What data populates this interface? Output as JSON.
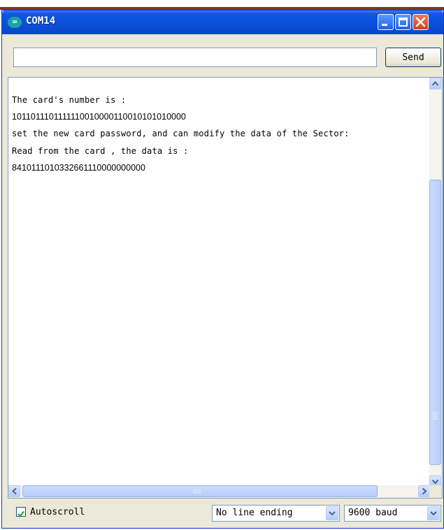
{
  "window": {
    "title": "COM14",
    "colors": {
      "titlebar": "#0a4fd8",
      "close_button": "#d2401c",
      "frame": "#ece9d8"
    }
  },
  "send_bar": {
    "input_value": "",
    "send_label": "Send"
  },
  "output": {
    "lines": [
      "The card's number is  :",
      "1011011101111110010000110010101010000",
      "set the new card password, and can modify the data of the Sector:",
      "Read from the card , the data is :",
      "8410111010332661110000000000"
    ]
  },
  "footer": {
    "autoscroll_label": "Autoscroll",
    "autoscroll_checked": true,
    "line_ending": "No line ending",
    "baud": "9600 baud"
  },
  "icons": [
    "arduino-icon",
    "minimize-icon",
    "maximize-icon",
    "close-icon",
    "scroll-up-icon",
    "scroll-down-icon",
    "scroll-left-icon",
    "scroll-right-icon",
    "checkmark-icon",
    "dropdown-arrow-icon"
  ]
}
